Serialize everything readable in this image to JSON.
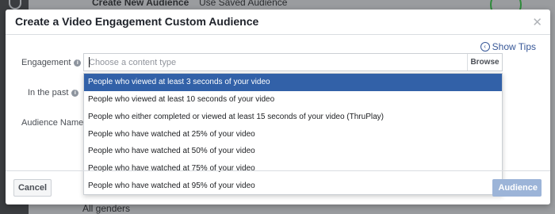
{
  "background": {
    "tab_create": "Create New Audience",
    "tab_saved": "Use Saved Audience",
    "bottom_text": "All genders"
  },
  "modal": {
    "title": "Create a Video Engagement Custom Audience",
    "show_tips": "Show Tips",
    "labels": {
      "engagement": "Engagement",
      "in_the_past": "In the past",
      "audience_name": "Audience Name"
    },
    "search": {
      "placeholder": "Choose a content type",
      "value": ""
    },
    "browse_label": "Browse",
    "options": [
      "People who viewed at least 3 seconds of your video",
      "People who viewed at least 10 seconds of your video",
      "People who either completed or viewed at least 15 seconds of your video (ThruPlay)",
      "People who have watched at 25% of your video",
      "People who have watched at 50% of your video",
      "People who have watched at 75% of your video",
      "People who have watched at 95% of your video"
    ],
    "selected_index": 0,
    "cancel_label": "Cancel",
    "create_label": "Audience"
  },
  "colors": {
    "selected_option": "#3261a8",
    "link": "#385898",
    "disabled_primary": "#9cb4d8"
  },
  "icons": {
    "close": "close-icon",
    "tips": "question-circle-icon",
    "info": "info-icon"
  }
}
